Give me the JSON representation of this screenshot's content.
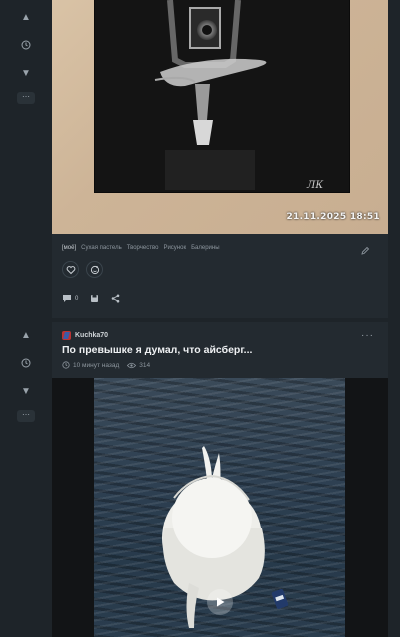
{
  "post1": {
    "timestamp": "21.11.2025  18:51",
    "tags": [
      "[моё]",
      "Сухая пастель",
      "Творчество",
      "Рисунок",
      "Балерины"
    ],
    "comments_count": "0"
  },
  "post2": {
    "author": "Kuchka70",
    "title": "По превышке я думал, что айсберг...",
    "time_ago": "10 минут назад",
    "views": "314"
  },
  "icons": {
    "vote_up": "arrow-up-icon",
    "vote_down": "arrow-down-icon",
    "history": "clock-icon",
    "more": "more-icon",
    "edit": "pencil-icon",
    "like": "heart-icon",
    "reaction": "add-reaction-icon",
    "comments": "comment-icon",
    "save": "save-icon",
    "share": "share-icon",
    "views": "eye-icon",
    "play": "play-icon"
  },
  "colors": {
    "background": "#1e2429",
    "card": "#232a30",
    "accent": "#4caf50"
  }
}
